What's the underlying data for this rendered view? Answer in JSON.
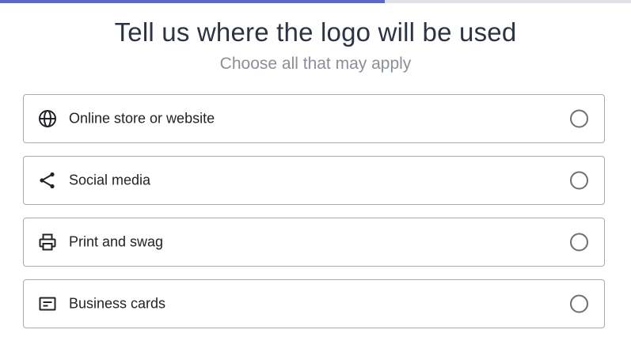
{
  "progress": {
    "fraction": 0.61,
    "fill_color": "#5c6ac4",
    "track_color": "#dfe3e8"
  },
  "header": {
    "title": "Tell us where the logo will be used",
    "subtitle": "Choose all that may apply"
  },
  "options": [
    {
      "label": "Online store or website",
      "icon": "globe-icon",
      "checked": false
    },
    {
      "label": "Social media",
      "icon": "share-icon",
      "checked": false
    },
    {
      "label": "Print and swag",
      "icon": "printer-icon",
      "checked": false
    },
    {
      "label": "Business cards",
      "icon": "card-icon",
      "checked": false
    }
  ]
}
